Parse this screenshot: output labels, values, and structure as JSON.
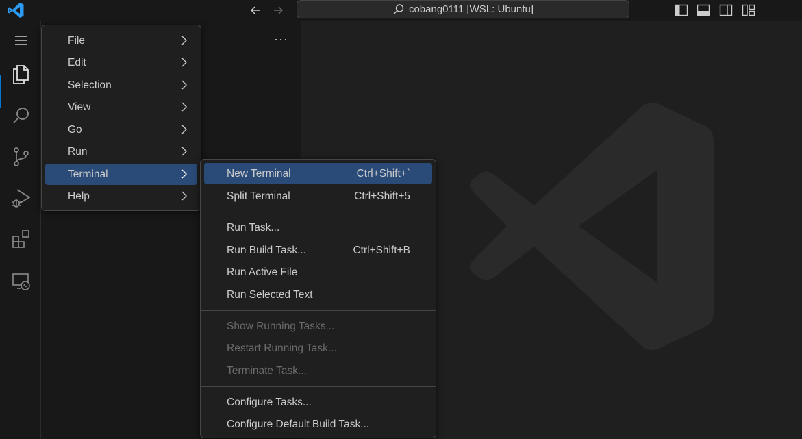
{
  "titlebar": {
    "command_center": "cobang0111 [WSL: Ubuntu]",
    "icons": [
      "vscode-logo-icon",
      "arrow-left-icon",
      "arrow-right-icon",
      "search-icon",
      "toggle-primary-sidebar-icon",
      "toggle-panel-icon",
      "toggle-secondary-sidebar-icon",
      "customize-layout-icon",
      "minimize-icon"
    ]
  },
  "activitybar": {
    "items": [
      "menu-icon",
      "explorer-icon",
      "search-icon",
      "source-control-icon",
      "run-debug-icon",
      "extensions-icon",
      "remote-explorer-icon"
    ]
  },
  "sidebar": {
    "more": "···"
  },
  "main_menu": {
    "items": [
      {
        "label": "File"
      },
      {
        "label": "Edit"
      },
      {
        "label": "Selection"
      },
      {
        "label": "View"
      },
      {
        "label": "Go"
      },
      {
        "label": "Run"
      },
      {
        "label": "Terminal"
      },
      {
        "label": "Help"
      }
    ]
  },
  "terminal_menu": {
    "items": [
      {
        "label": "New Terminal",
        "shortcut": "Ctrl+Shift+`"
      },
      {
        "label": "Split Terminal",
        "shortcut": "Ctrl+Shift+5"
      },
      {
        "label": "Run Task..."
      },
      {
        "label": "Run Build Task...",
        "shortcut": "Ctrl+Shift+B"
      },
      {
        "label": "Run Active File"
      },
      {
        "label": "Run Selected Text"
      },
      {
        "label": "Show Running Tasks..."
      },
      {
        "label": "Restart Running Task..."
      },
      {
        "label": "Terminate Task..."
      },
      {
        "label": "Configure Tasks..."
      },
      {
        "label": "Configure Default Build Task..."
      }
    ]
  },
  "colors": {
    "accent": "#0078d4",
    "selection": "#2a4a78",
    "disabled_text": "#6b6b6b"
  }
}
